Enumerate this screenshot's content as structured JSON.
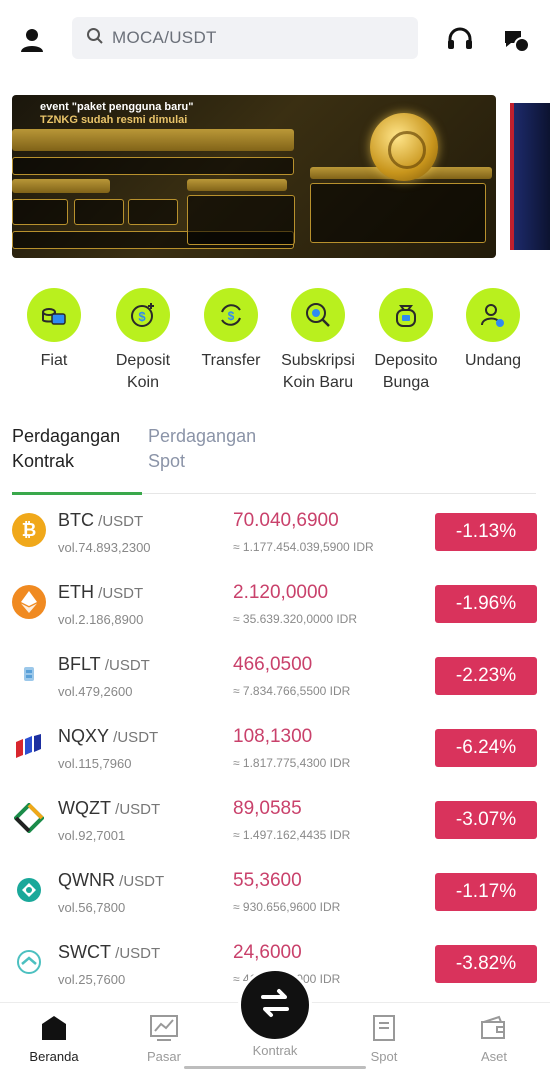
{
  "header": {
    "search_placeholder": "MOCA/USDT",
    "icons": [
      "user-icon",
      "search-icon",
      "headset-icon",
      "chat-icon"
    ]
  },
  "banner": {
    "title": "event \"paket pengguna baru\"",
    "subtitle": "TZNKG sudah resmi dimulai"
  },
  "quick_menu": [
    {
      "label": "Fiat",
      "icon": "wallet-coins-icon"
    },
    {
      "label": "Deposit Koin",
      "icon": "dollar-plus-icon"
    },
    {
      "label": "Transfer",
      "icon": "dollar-transfer-icon"
    },
    {
      "label": "Subskripsi Koin Baru",
      "icon": "coin-search-icon"
    },
    {
      "label": "Deposito Bunga",
      "icon": "money-bag-icon"
    },
    {
      "label": "Undang",
      "icon": "user-add-icon"
    }
  ],
  "tabs": [
    {
      "label": "Perdagangan Kontrak",
      "active": true
    },
    {
      "label": "Perdagangan Spot",
      "active": false
    }
  ],
  "market": [
    {
      "symbol": "BTC",
      "pair": " /USDT",
      "vol": "vol.74.893,2300",
      "price": "70.040,6900",
      "idr": "≈ 1.177.454.039,5900 IDR",
      "change": "-1.13%",
      "color": "#f0a81a"
    },
    {
      "symbol": "ETH",
      "pair": " /USDT",
      "vol": "vol.2.186,8900",
      "price": "2.120,0000",
      "idr": "≈ 35.639.320,0000 IDR",
      "change": "-1.96%",
      "color": "#f08a21"
    },
    {
      "symbol": "BFLT",
      "pair": " /USDT",
      "vol": "vol.479,2600",
      "price": "466,0500",
      "idr": "≈ 7.834.766,5500 IDR",
      "change": "-2.23%",
      "color": "#5aa0d8"
    },
    {
      "symbol": "NQXY",
      "pair": " /USDT",
      "vol": "vol.115,7960",
      "price": "108,1300",
      "idr": "≈ 1.817.775,4300 IDR",
      "change": "-6.24%",
      "color": "#2c4fd1"
    },
    {
      "symbol": "WQZT",
      "pair": " /USDT",
      "vol": "vol.92,7001",
      "price": "89,0585",
      "idr": "≈ 1.497.162,4435 IDR",
      "change": "-3.07%",
      "color": "#1b8c4a"
    },
    {
      "symbol": "QWNR",
      "pair": " /USDT",
      "vol": "vol.56,7800",
      "price": "55,3600",
      "idr": "≈ 930.656,9600 IDR",
      "change": "-1.17%",
      "color": "#1aa89a"
    },
    {
      "symbol": "SWCT",
      "pair": " /USDT",
      "vol": "vol.25,7600",
      "price": "24,6000",
      "idr": "≈ 413.550,6000 IDR",
      "change": "-3.82%",
      "color": "#4cc0c0"
    }
  ],
  "bottom_nav": [
    {
      "label": "Beranda",
      "active": true
    },
    {
      "label": "Pasar",
      "active": false
    },
    {
      "label": "Kontrak",
      "active": false
    },
    {
      "label": "Spot",
      "active": false
    },
    {
      "label": "Aset",
      "active": false
    }
  ],
  "colors": {
    "accent_green": "#b9f01e",
    "negative": "#d9335c",
    "price": "#c9416b",
    "tab_underline": "#3aa84b"
  }
}
